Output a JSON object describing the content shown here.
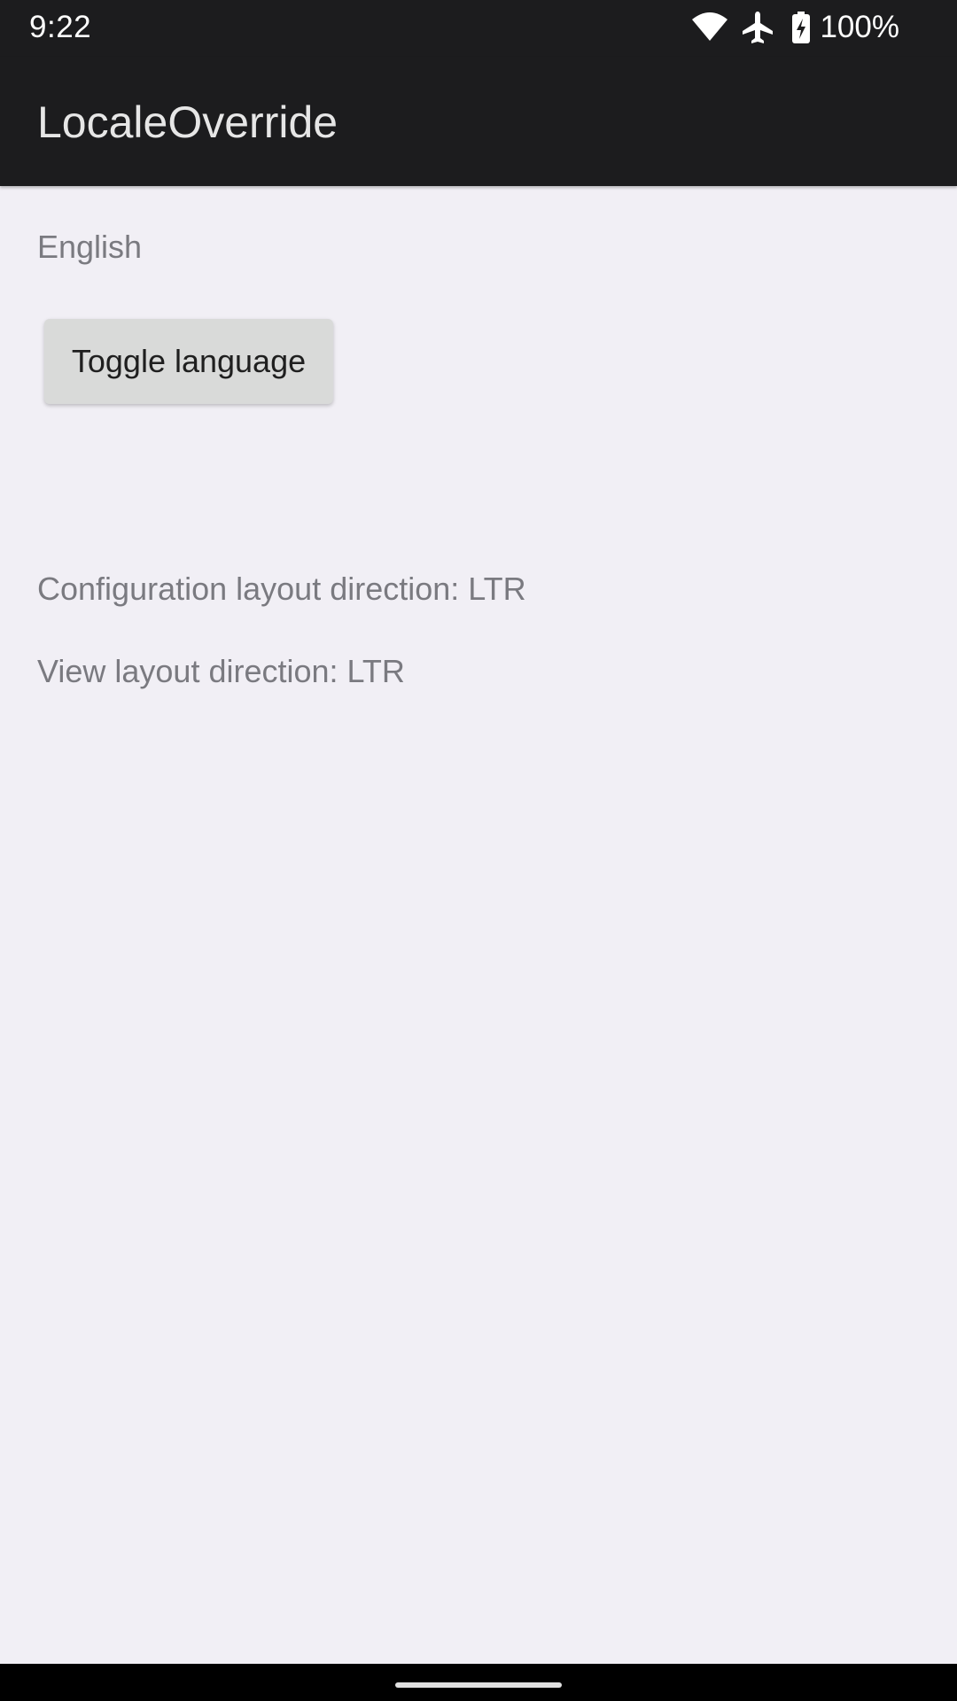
{
  "status_bar": {
    "time": "9:22",
    "battery_percent": "100%",
    "icons": [
      "wifi-icon",
      "airplane-icon",
      "battery-charging-icon"
    ]
  },
  "app_bar": {
    "title": "LocaleOverride"
  },
  "main": {
    "locale_label": "English",
    "toggle_button_label": "Toggle language",
    "configuration_direction": "Configuration layout direction: LTR",
    "view_direction": "View layout direction: LTR"
  },
  "colors": {
    "app_bar_background": "#1c1c1e",
    "content_background": "#f1eff5",
    "button_background": "#d9dad9",
    "secondary_text": "#7a7a80"
  }
}
